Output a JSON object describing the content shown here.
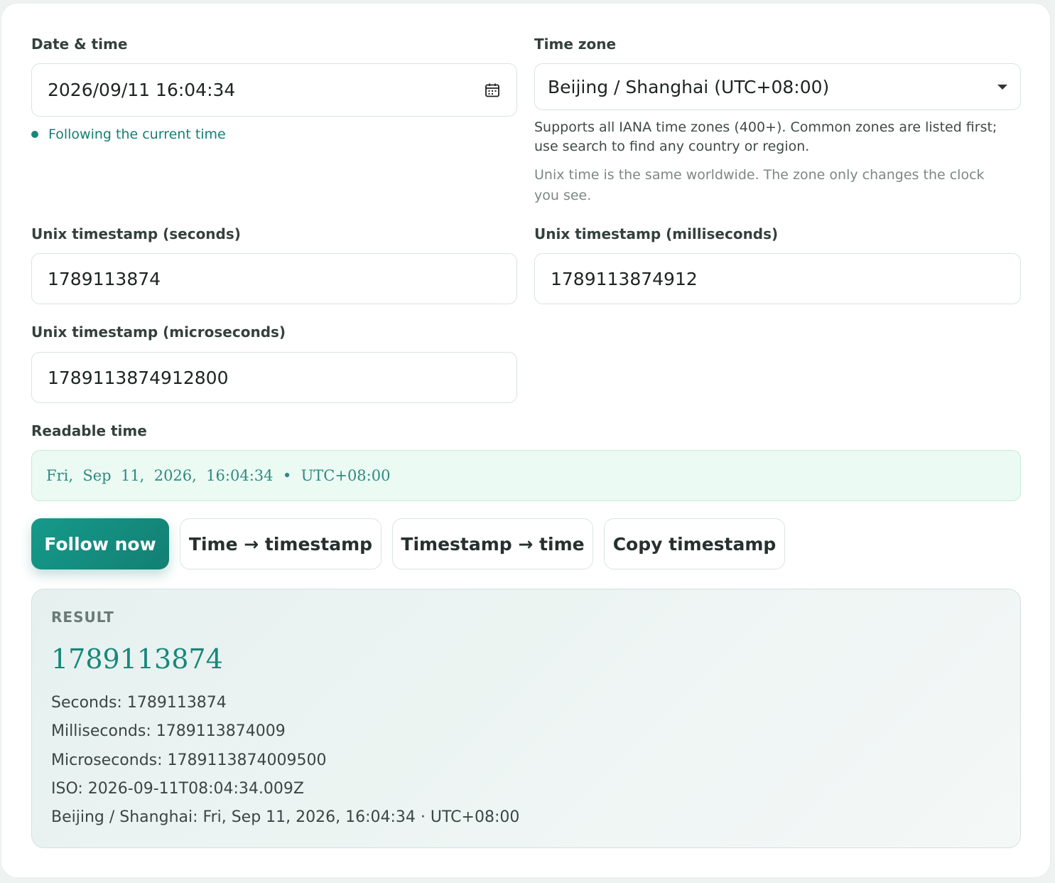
{
  "datetime": {
    "label": "Date & time",
    "value": "2026/09/11  16:04:34",
    "icon": "calendar-icon",
    "status": "Following the current time"
  },
  "timezone": {
    "label": "Time zone",
    "selected": "Beijing / Shanghai (UTC+08:00)",
    "hint": "Supports all IANA time zones (400+). Common zones are listed first; use search to find any country or region.",
    "note": "Unix time is the same worldwide. The zone only changes the clock you see."
  },
  "unix_seconds": {
    "label": "Unix timestamp (seconds)",
    "value": "1789113874"
  },
  "unix_milliseconds": {
    "label": "Unix timestamp (milliseconds)",
    "value": "1789113874912"
  },
  "unix_microseconds": {
    "label": "Unix timestamp (microseconds)",
    "value": "1789113874912800"
  },
  "readable": {
    "label": "Readable time",
    "value": "Fri,  Sep  11,  2026,  16:04:34  •  UTC+08:00"
  },
  "buttons": {
    "follow_now": "Follow now",
    "time_to_timestamp": "Time → timestamp",
    "timestamp_to_time": "Timestamp → time",
    "copy_timestamp": "Copy timestamp"
  },
  "result": {
    "title": "RESULT",
    "primary": "1789113874",
    "lines": [
      "Seconds: 1789113874",
      "Milliseconds: 1789113874009",
      "Microseconds: 1789113874009500",
      "ISO: 2026-09-11T08:04:34.009Z",
      "Beijing / Shanghai: Fri, Sep 11, 2026, 16:04:34 · UTC+08:00"
    ]
  },
  "colors": {
    "accent": "#137f73",
    "readable_bg": "#ebfaf3",
    "result_bg": "#e6f1ef"
  }
}
